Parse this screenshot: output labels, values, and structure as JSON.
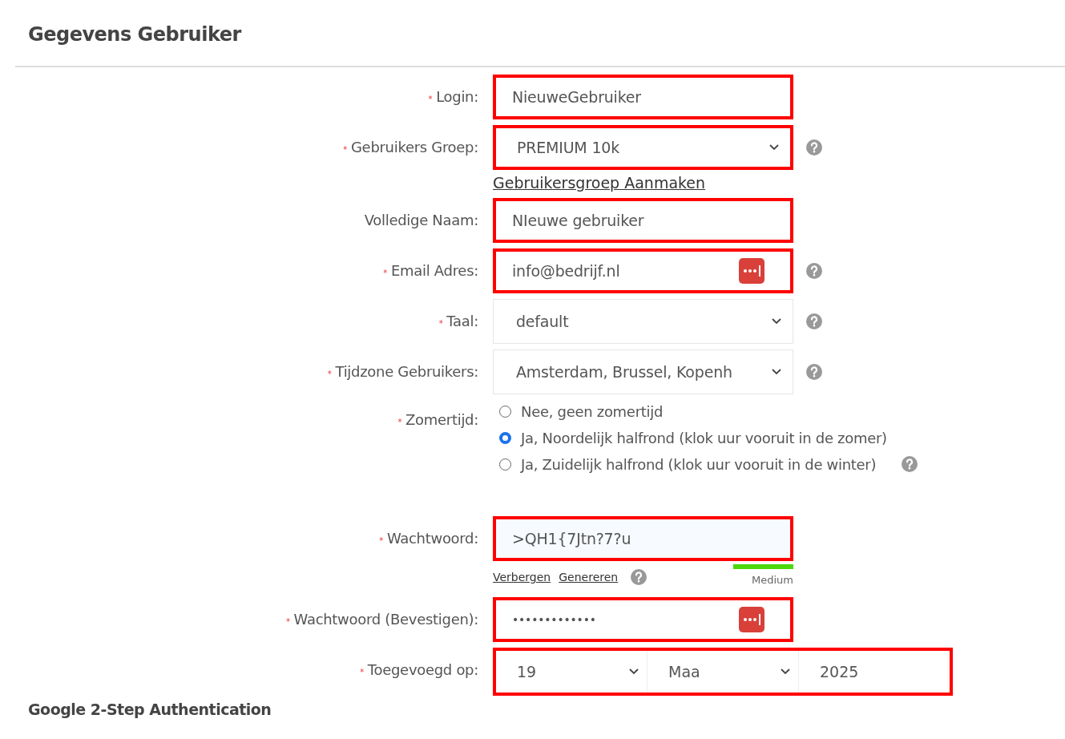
{
  "title": "Gegevens Gebruiker",
  "fields": [
    {
      "kind": "text",
      "required_mark": "*",
      "label": "Login:",
      "value": "NieuweGebruiker",
      "highlighted": true
    },
    {
      "kind": "select",
      "required_mark": "*",
      "label": "Gebruikers Groep:",
      "value": "PREMIUM 10k",
      "highlighted": true,
      "help": true,
      "link": "Gebruikersgroep Aanmaken"
    },
    {
      "kind": "text",
      "label": "Volledige Naam:",
      "value": "NIeuwe gebruiker",
      "highlighted": true
    },
    {
      "kind": "text",
      "required_mark": "*",
      "label": "Email Adres:",
      "value": "info@bedrijf.nl",
      "highlighted": true,
      "help": true,
      "manager_icon": true
    },
    {
      "kind": "select",
      "required_mark": "*",
      "label": "Taal:",
      "value": "default",
      "highlighted": false,
      "help": true
    },
    {
      "kind": "select",
      "required_mark": "*",
      "label": "Tijdzone Gebruikers:",
      "value": "Amsterdam, Brussel, Kopenh",
      "highlighted": false,
      "help": true
    },
    {
      "kind": "radio",
      "required_mark": "*",
      "label": "Zomertijd:",
      "help": true,
      "options": [
        {
          "label": "Nee, geen zomertijd",
          "selected": false
        },
        {
          "label": "Ja, Noordelijk halfrond (klok uur vooruit in de zomer)",
          "selected": true
        },
        {
          "label": "Ja, Zuidelijk halfrond (klok uur vooruit in de winter)",
          "selected": false
        }
      ]
    },
    {
      "kind": "password",
      "required_mark": "*",
      "label": "Wachtwoord:",
      "value": ">QH1{7Jtn?7?u",
      "highlighted": true,
      "links": [
        "Verbergen",
        "Genereren"
      ],
      "help": true,
      "strength_label": "Medium"
    },
    {
      "kind": "text",
      "required_mark": "*",
      "label": "Wachtwoord (Bevestigen):",
      "value": "•••••••••••••",
      "masked": true,
      "highlighted": true,
      "manager_icon": true
    },
    {
      "kind": "date",
      "required_mark": "*",
      "label": "Toegevoegd op:",
      "highlighted": true,
      "day": "19",
      "month": "Maa",
      "year": "2025"
    }
  ],
  "next_section": "Google 2-Step Authentication"
}
